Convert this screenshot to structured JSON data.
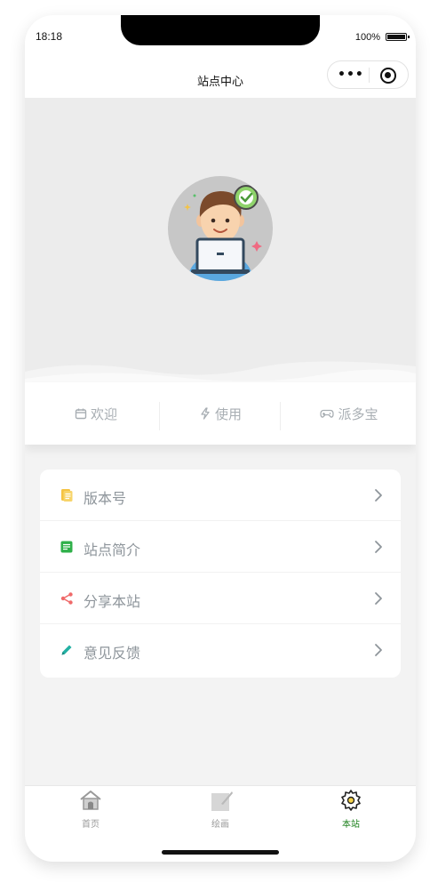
{
  "status_bar": {
    "time": "18:18",
    "battery": "100%"
  },
  "navbar": {
    "title": "站点中心"
  },
  "tabs": [
    {
      "label": "欢迎",
      "icon": "calendar-icon"
    },
    {
      "label": "使用",
      "icon": "lightning-icon"
    },
    {
      "label": "派多宝",
      "icon": "gamepad-icon"
    }
  ],
  "menu": [
    {
      "label": "版本号",
      "icon": "document-icon",
      "color": "#f5c342"
    },
    {
      "label": "站点简介",
      "icon": "profile-card-icon",
      "color": "#2fb04a"
    },
    {
      "label": "分享本站",
      "icon": "share-icon",
      "color": "#ef6a6a"
    },
    {
      "label": "意见反馈",
      "icon": "pencil-icon",
      "color": "#22b0a3"
    }
  ],
  "tabbar": [
    {
      "label": "首页",
      "icon": "house-icon",
      "active": false
    },
    {
      "label": "绘画",
      "icon": "drawing-icon",
      "active": false
    },
    {
      "label": "本站",
      "icon": "gear-icon",
      "active": true
    }
  ],
  "colors": {
    "accent": "#1a7f1a",
    "menu_text": "#8e959b",
    "tab_text": "#a8aeb3"
  }
}
